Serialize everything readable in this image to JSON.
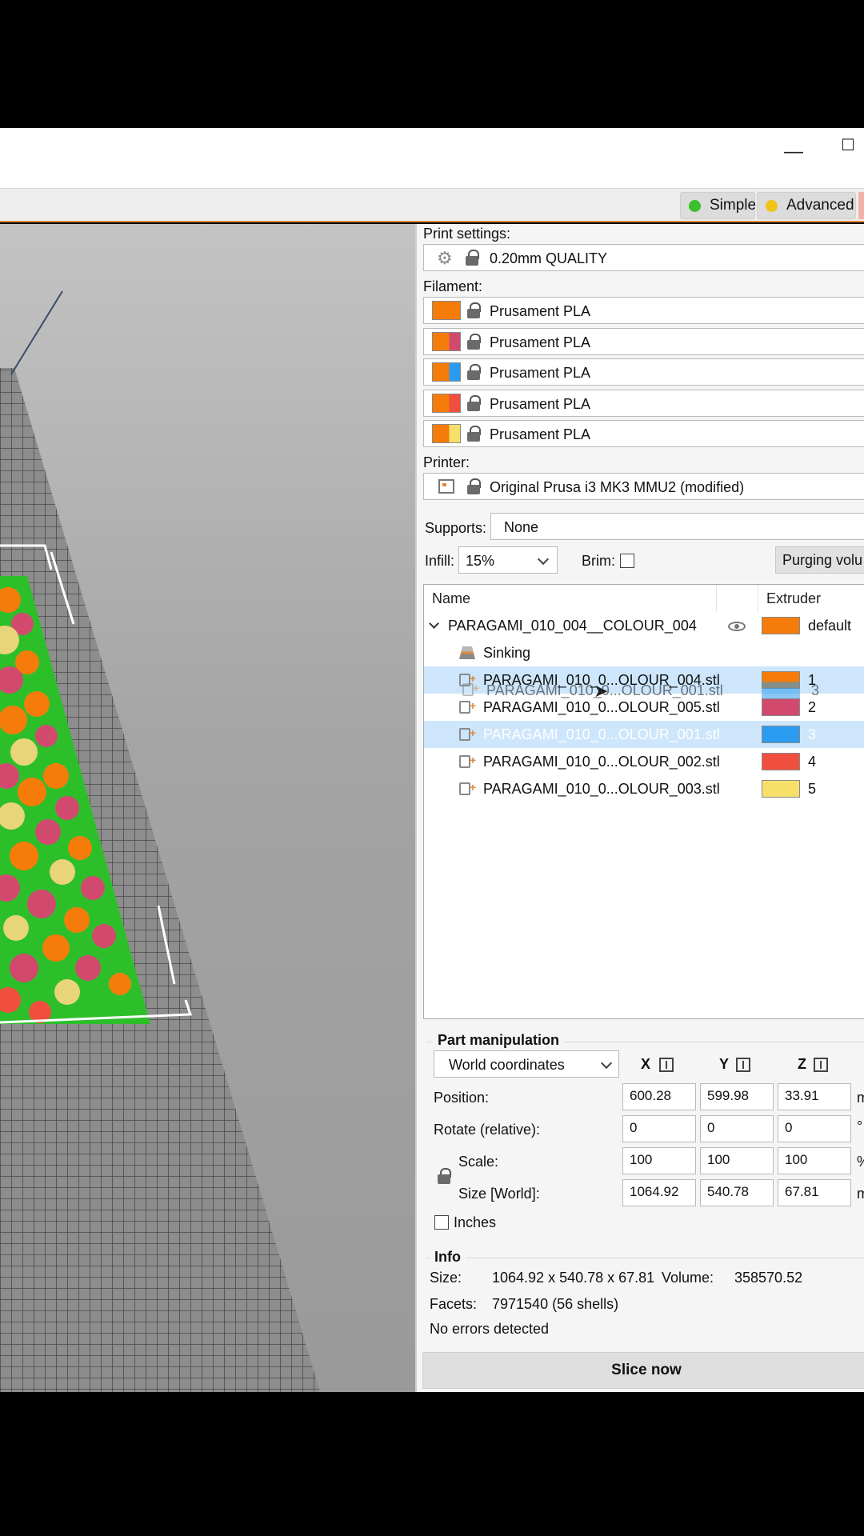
{
  "window": {
    "minimize_icon": "minimize-icon",
    "maximize_icon": "maximize-icon"
  },
  "modes": {
    "simple": {
      "label": "Simple",
      "color": "#3cbf2c"
    },
    "advanced": {
      "label": "Advanced",
      "color": "#f0c419"
    }
  },
  "print_settings": {
    "label": "Print settings:",
    "value": "0.20mm QUALITY"
  },
  "filament": {
    "label": "Filament:",
    "items": [
      {
        "name": "Prusament PLA",
        "colors": [
          "#f57c0a"
        ]
      },
      {
        "name": "Prusament PLA",
        "colors": [
          "#f57c0a",
          "#d14a6e"
        ]
      },
      {
        "name": "Prusament PLA",
        "colors": [
          "#f57c0a",
          "#2b9bef"
        ]
      },
      {
        "name": "Prusament PLA",
        "colors": [
          "#f57c0a",
          "#f04e3e"
        ]
      },
      {
        "name": "Prusament PLA",
        "colors": [
          "#f57c0a",
          "#f7e06a"
        ]
      }
    ]
  },
  "printer": {
    "label": "Printer:",
    "value": "Original Prusa i3 MK3 MMU2 (modified)"
  },
  "supports": {
    "label": "Supports:",
    "value": "None"
  },
  "infill": {
    "label": "Infill:",
    "value": "15%"
  },
  "brim": {
    "label": "Brim:",
    "checked": false
  },
  "purging": {
    "label": "Purging volu"
  },
  "object_list": {
    "col_name": "Name",
    "col_extruder": "Extruder",
    "object": {
      "name": "PARAGAMI_010_004__COLOUR_004",
      "extruder": "default",
      "color": "#f57c0a"
    },
    "sinking": "Sinking",
    "parts": [
      {
        "name": "PARAGAMI_010_0...OLOUR_004.stl",
        "extruder": "1",
        "color": "#f57c0a"
      },
      {
        "name": "PARAGAMI_010_0...OLOUR_005.stl",
        "extruder": "2",
        "color": "#d14a6e"
      },
      {
        "name": "PARAGAMI_010_0...OLOUR_001.stl",
        "extruder": "3",
        "color": "#2b9bef"
      },
      {
        "name": "PARAGAMI_010_0...OLOUR_002.stl",
        "extruder": "4",
        "color": "#f04e3e"
      },
      {
        "name": "PARAGAMI_010_0...OLOUR_003.stl",
        "extruder": "5",
        "color": "#f7e06a"
      }
    ],
    "drag_ghost": {
      "name": "PARAGAMI_010_0...OLOUR_001.stl",
      "extruder": "3"
    }
  },
  "part_manipulation": {
    "title": "Part manipulation",
    "coord_system": "World coordinates",
    "axes": [
      "X",
      "Y",
      "Z"
    ],
    "position": {
      "label": "Position:",
      "values": [
        "600.28",
        "599.98",
        "33.91"
      ],
      "unit": "m"
    },
    "rotate": {
      "label": "Rotate (relative):",
      "values": [
        "0",
        "0",
        "0"
      ],
      "unit": "°"
    },
    "scale": {
      "label": "Scale:",
      "values": [
        "100",
        "100",
        "100"
      ],
      "unit": "%"
    },
    "size": {
      "label": "Size [World]:",
      "values": [
        "1064.92",
        "540.78",
        "67.81"
      ],
      "unit": "m"
    },
    "inches": {
      "label": "Inches",
      "checked": false
    }
  },
  "info": {
    "title": "Info",
    "size_label": "Size:",
    "size_value": "1064.92 x 540.78 x 67.81",
    "volume_label": "Volume:",
    "volume_value": "358570.52",
    "facets_label": "Facets:",
    "facets_value": "7971540 (56 shells)",
    "errors": "No errors detected"
  },
  "slice_button": "Slice now"
}
